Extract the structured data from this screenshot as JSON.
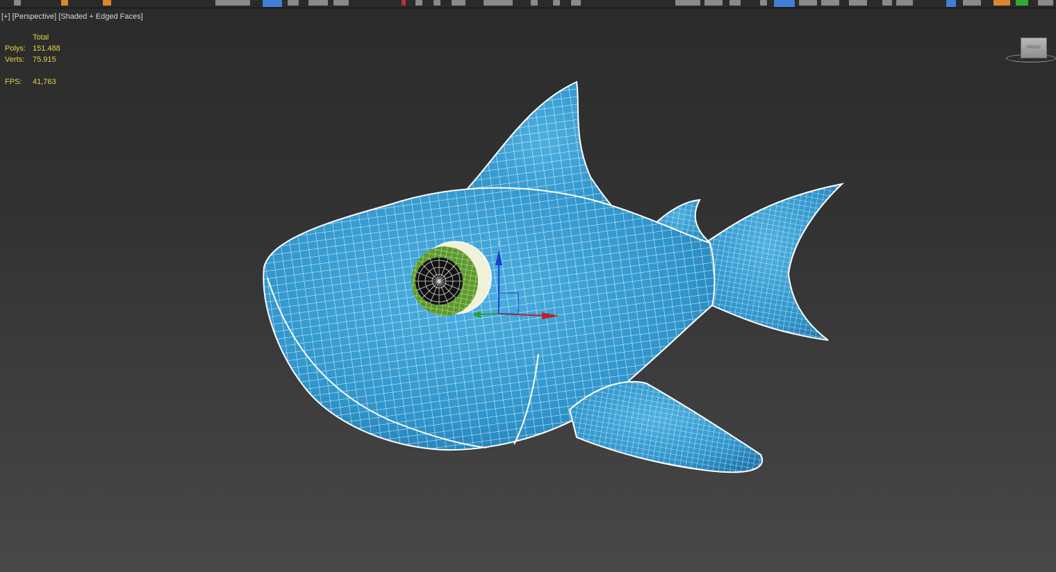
{
  "viewport": {
    "menu_plus": "[+]",
    "view_mode": "[Perspective]",
    "shading_mode": "[Shaded + Edged Faces]"
  },
  "stats": {
    "header": "Total",
    "polys_label": "Polys:",
    "polys_value": "151.488",
    "verts_label": "Verts:",
    "verts_value": "75.915",
    "fps_label": "FPS:",
    "fps_value": "41,763"
  },
  "viewcube": {
    "face_label": "FRONT"
  },
  "gizmo": {
    "axis_z": "Z"
  },
  "colors": {
    "background_top": "#2b2b2b",
    "background_bottom": "#484848",
    "stats_text": "#e5d24a",
    "shark_body": "#2f95cc",
    "wire": "#ffffff",
    "eye_iris": "#5d9a2a",
    "axis_z": "#1a3fd0",
    "axis_x": "#c0202a",
    "axis_y": "#2aa02a"
  },
  "icons": [
    "viewcube-icon",
    "transform-gizmo-icon"
  ]
}
